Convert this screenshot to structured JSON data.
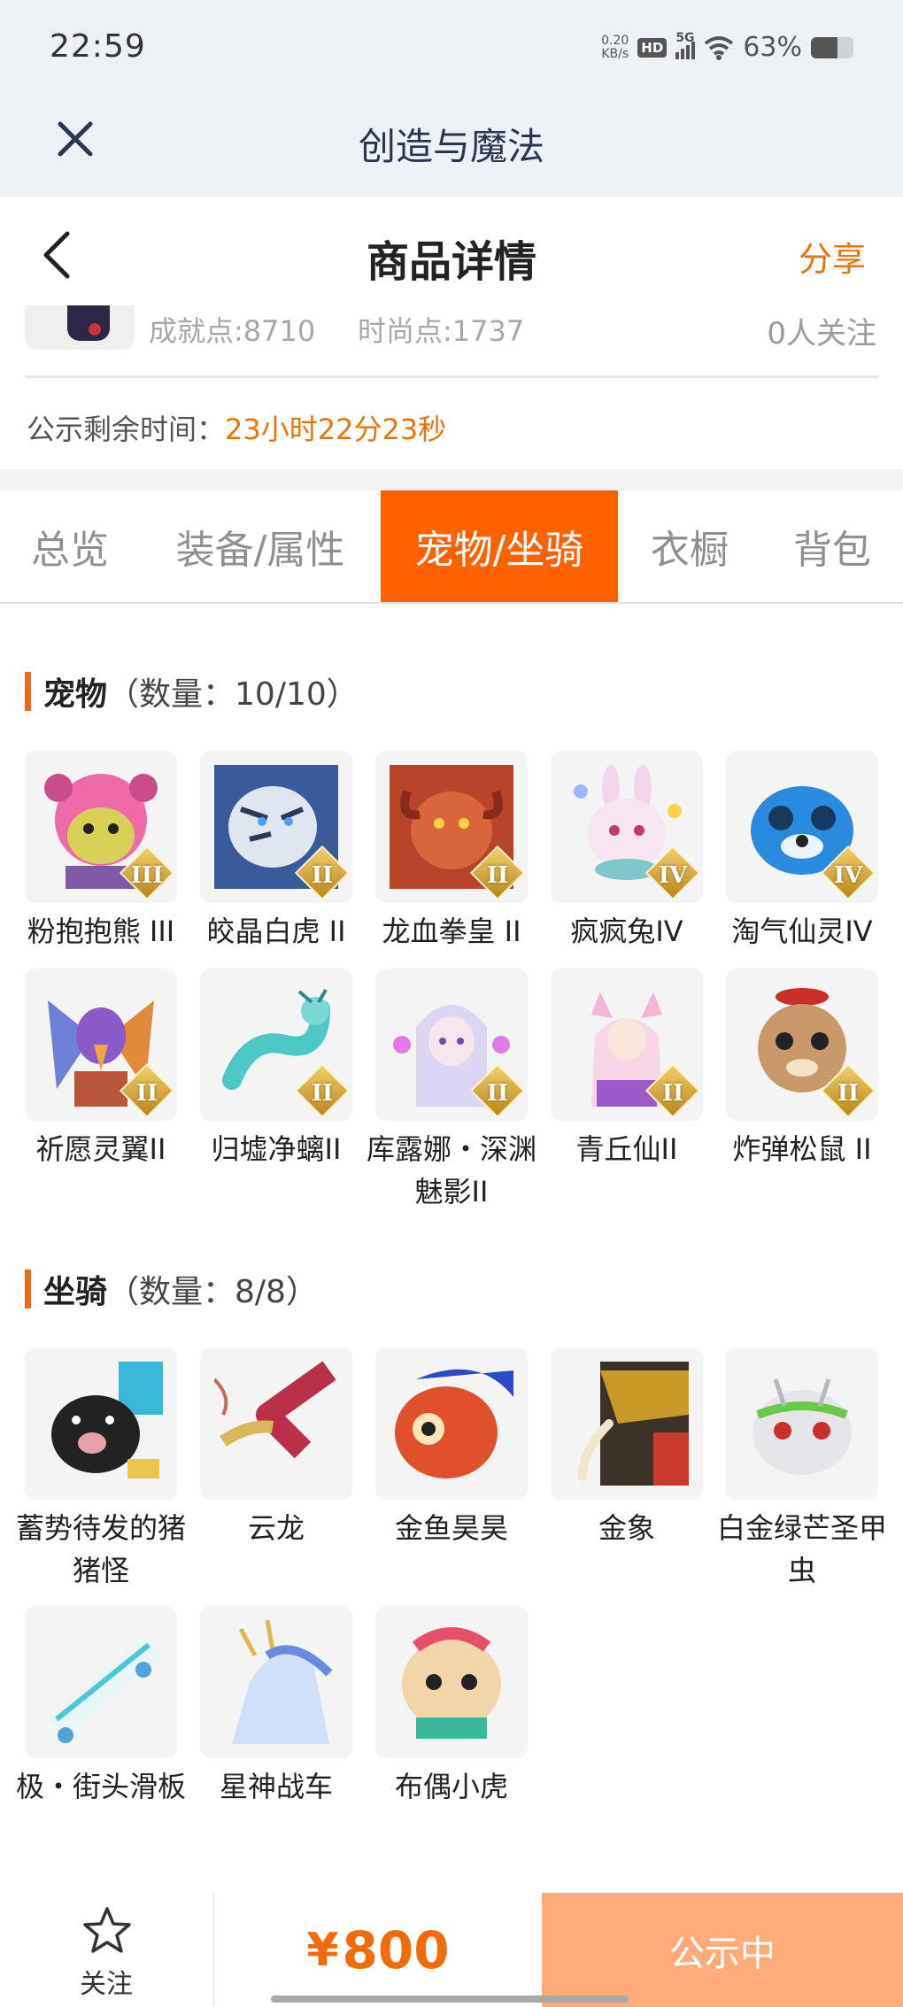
{
  "status_bar": {
    "time": "22:59",
    "net_speed_value": "0.20",
    "net_speed_unit": "KB/s",
    "hd": "HD",
    "network": "5G",
    "battery_percent": "63%",
    "battery_level": 0.63
  },
  "app_header": {
    "title": "创造与魔法",
    "close_icon": "close-icon"
  },
  "page_header": {
    "title": "商品详情",
    "share_label": "分享",
    "back_icon": "chevron-left-icon"
  },
  "stats": {
    "achievement": "成就点:8710",
    "fashion": "时尚点:1737",
    "followers": "0人关注"
  },
  "publicity": {
    "label": "公示剩余时间：",
    "countdown": "23小时22分23秒"
  },
  "tabs": [
    {
      "label": "总览"
    },
    {
      "label": "装备/属性"
    },
    {
      "label": "宠物/坐骑",
      "active": true
    },
    {
      "label": "衣橱"
    },
    {
      "label": "背包"
    }
  ],
  "pets": {
    "title": "宠物",
    "count": "（数量：10/10）",
    "items": [
      {
        "name": "粉抱抱熊 III",
        "tier": "III"
      },
      {
        "name": "皎晶白虎 II",
        "tier": "II"
      },
      {
        "name": "龙血拳皇 II",
        "tier": "II"
      },
      {
        "name": "疯疯兔IV",
        "tier": "IV"
      },
      {
        "name": "淘气仙灵IV",
        "tier": "IV"
      },
      {
        "name": "祈愿灵翼II",
        "tier": "II"
      },
      {
        "name": "归墟净螭II",
        "tier": "II"
      },
      {
        "name": "库露娜・深渊魅影II",
        "tier": "II"
      },
      {
        "name": "青丘仙II",
        "tier": "II"
      },
      {
        "name": "炸弹松鼠 II",
        "tier": "II"
      }
    ]
  },
  "mounts": {
    "title": "坐骑",
    "count": "（数量：8/8）",
    "items": [
      {
        "name": "蓄势待发的猪猪怪"
      },
      {
        "name": "云龙"
      },
      {
        "name": "金鱼昊昊"
      },
      {
        "name": "金象"
      },
      {
        "name": "白金绿芒圣甲虫"
      },
      {
        "name": "极・街头滑板"
      },
      {
        "name": "星神战车"
      },
      {
        "name": "布偶小虎"
      }
    ]
  },
  "bottom_bar": {
    "follow_label": "关注",
    "currency": "¥",
    "price": "800",
    "status_label": "公示中"
  },
  "colors": {
    "accent": "#ff6000",
    "price": "#f26b0a",
    "status_button": "#ffac7b",
    "countdown": "#e8750c"
  }
}
